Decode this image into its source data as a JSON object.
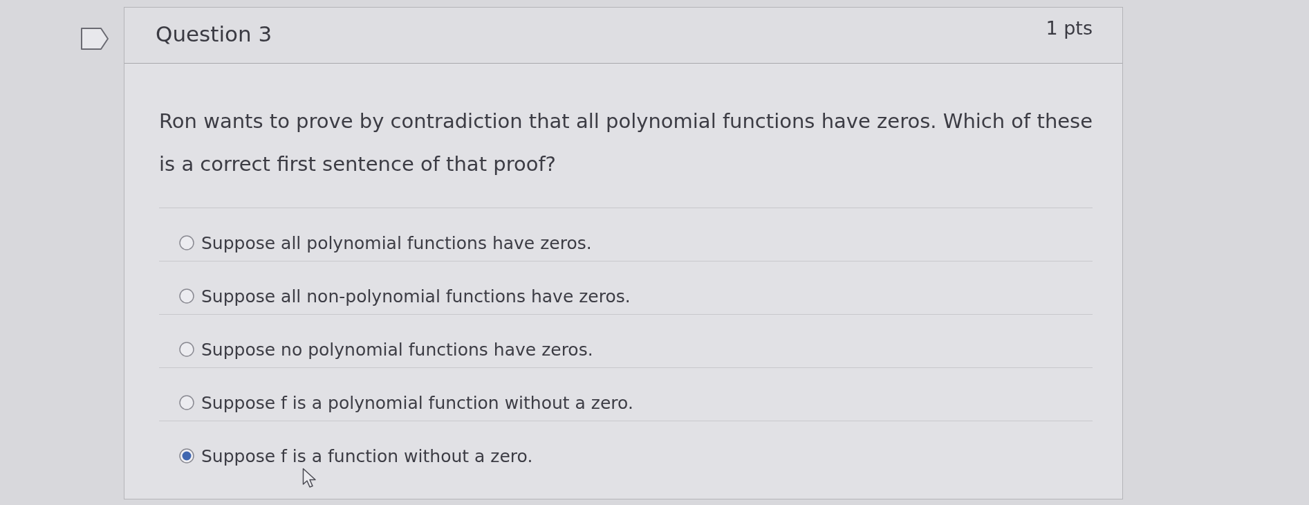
{
  "flag": {
    "flagged": false
  },
  "question": {
    "title": "Question 3",
    "points": "1 pts",
    "text": "Ron wants to prove by contradiction that all polynomial functions have zeros. Which of these is a correct first sentence of that proof?",
    "options": [
      {
        "label": "Suppose all polynomial functions have zeros.",
        "selected": false
      },
      {
        "label": "Suppose all non-polynomial functions have zeros.",
        "selected": false
      },
      {
        "label": "Suppose no polynomial functions have zeros.",
        "selected": false
      },
      {
        "label": "Suppose f is a polynomial function without a zero.",
        "selected": false
      },
      {
        "label": "Suppose f is a function without a zero.",
        "selected": true
      }
    ]
  }
}
